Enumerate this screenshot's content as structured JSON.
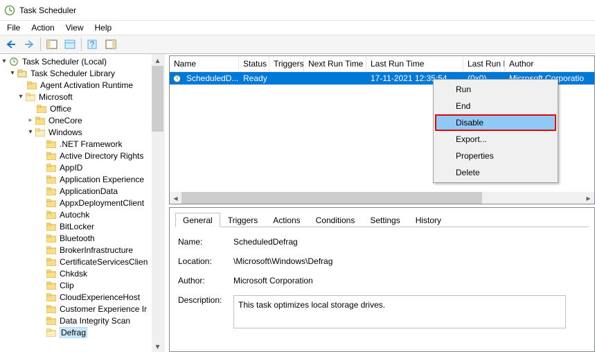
{
  "window": {
    "title": "Task Scheduler"
  },
  "menubar": {
    "file": "File",
    "action": "Action",
    "view": "View",
    "help": "Help"
  },
  "tree": {
    "root": "Task Scheduler (Local)",
    "library": "Task Scheduler Library",
    "agent": "Agent Activation Runtime",
    "microsoft": "Microsoft",
    "office": "Office",
    "onecore": "OneCore",
    "windows": "Windows",
    "items": [
      ".NET Framework",
      "Active Directory Rights",
      "AppID",
      "Application Experience",
      "ApplicationData",
      "AppxDeploymentClient",
      "Autochk",
      "BitLocker",
      "Bluetooth",
      "BrokerInfrastructure",
      "CertificateServicesClien",
      "Chkdsk",
      "Clip",
      "CloudExperienceHost",
      "Customer Experience Ir",
      "Data Integrity Scan",
      "Defrag"
    ]
  },
  "grid": {
    "columns": {
      "name": "Name",
      "status": "Status",
      "triggers": "Triggers",
      "next": "Next Run Time",
      "last": "Last Run Time",
      "result": "Last Run Result",
      "author": "Author"
    },
    "row": {
      "name": "ScheduledD...",
      "status": "Ready",
      "triggers": "",
      "next": "",
      "last": "17-11-2021 12:35:54",
      "result": "(0x0)",
      "author": "Microsoft Corporatio"
    }
  },
  "context_menu": {
    "run": "Run",
    "end": "End",
    "disable": "Disable",
    "export": "Export...",
    "properties": "Properties",
    "delete": "Delete"
  },
  "tabs": {
    "general": "General",
    "triggers": "Triggers",
    "actions": "Actions",
    "conditions": "Conditions",
    "settings": "Settings",
    "history": "History"
  },
  "details": {
    "name_label": "Name:",
    "name_value": "ScheduledDefrag",
    "location_label": "Location:",
    "location_value": "\\Microsoft\\Windows\\Defrag",
    "author_label": "Author:",
    "author_value": "Microsoft Corporation",
    "description_label": "Description:",
    "description_value": "This task optimizes local storage drives."
  }
}
